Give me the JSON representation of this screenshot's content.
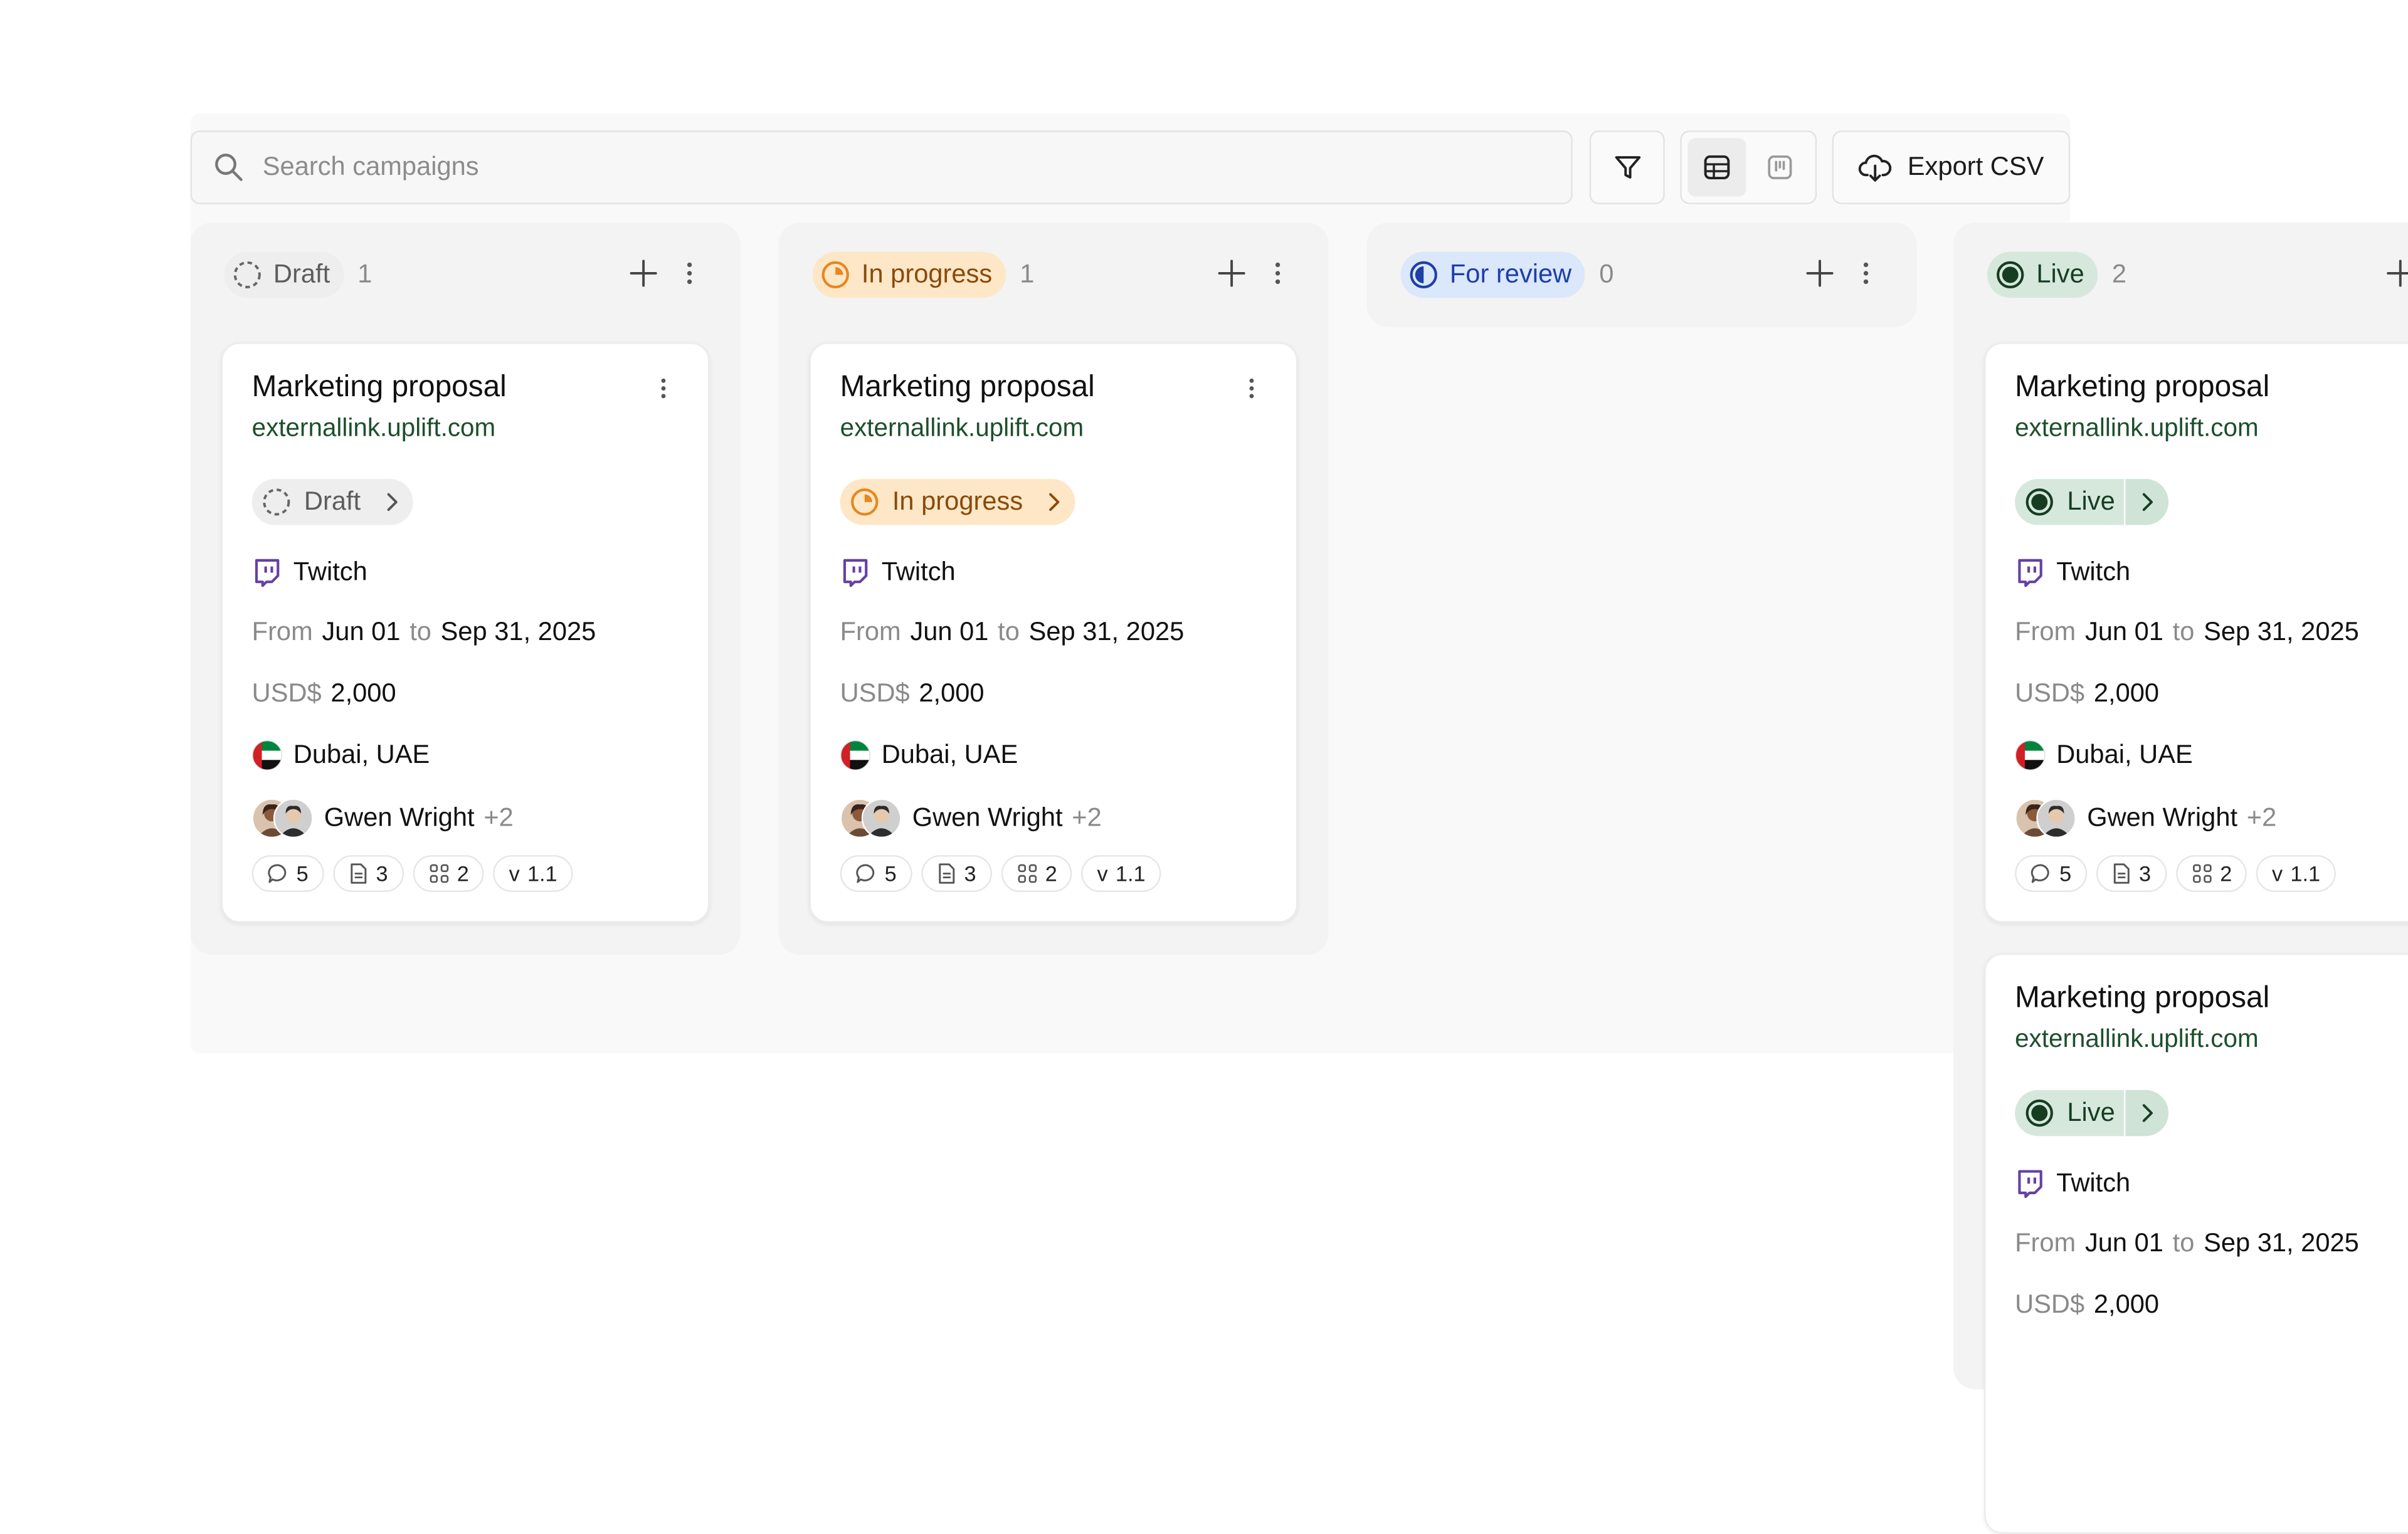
{
  "search": {
    "placeholder": "Search campaigns"
  },
  "toolbar": {
    "export_label": "Export CSV"
  },
  "columns": [
    {
      "status": "Draft",
      "count": "1",
      "cards": [
        {
          "title": "Marketing proposal",
          "link": "externallink.uplift.com",
          "status": "Draft",
          "platform": "Twitch",
          "from_label": "From",
          "from_date": "Jun 01",
          "to_label": "to",
          "to_date": "Sep 31, 2025",
          "currency": "USD$",
          "amount": "2,000",
          "location": "Dubai, UAE",
          "owner": "Gwen Wright",
          "extra": "+2",
          "comments": "5",
          "files": "3",
          "components": "2",
          "version_prefix": "v",
          "version": "1.1"
        }
      ]
    },
    {
      "status": "In progress",
      "count": "1",
      "cards": [
        {
          "title": "Marketing proposal",
          "link": "externallink.uplift.com",
          "status": "In progress",
          "platform": "Twitch",
          "from_label": "From",
          "from_date": "Jun 01",
          "to_label": "to",
          "to_date": "Sep 31, 2025",
          "currency": "USD$",
          "amount": "2,000",
          "location": "Dubai, UAE",
          "owner": "Gwen Wright",
          "extra": "+2",
          "comments": "5",
          "files": "3",
          "components": "2",
          "version_prefix": "v",
          "version": "1.1"
        }
      ]
    },
    {
      "status": "For review",
      "count": "0",
      "cards": []
    },
    {
      "status": "Live",
      "count": "2",
      "cards": [
        {
          "title": "Marketing proposal",
          "link": "externallink.uplift.com",
          "status": "Live",
          "platform": "Twitch",
          "from_label": "From",
          "from_date": "Jun 01",
          "to_label": "to",
          "to_date": "Sep 31, 2025",
          "currency": "USD$",
          "amount": "2,000",
          "location": "Dubai, UAE",
          "owner": "Gwen Wright",
          "extra": "+2",
          "comments": "5",
          "files": "3",
          "components": "2",
          "version_prefix": "v",
          "version": "1.1"
        },
        {
          "title": "Marketing proposal",
          "link": "externallink.uplift.com",
          "status": "Live",
          "platform": "Twitch",
          "from_label": "From",
          "from_date": "Jun 01",
          "to_label": "to",
          "to_date": "Sep 31, 2025",
          "currency": "USD$",
          "amount": "2,000"
        }
      ]
    }
  ],
  "colors": {
    "draft_bg": "#eeeeee",
    "draft_fg": "#5c5c5c",
    "progress_bg": "#fde7c7",
    "progress_fg": "#8a4a0b",
    "progress_icon": "#e8861f",
    "review_bg": "#dbe7fb",
    "review_fg": "#1d3fa6",
    "live_bg": "#d6e8dc",
    "live_fg": "#163d22",
    "link": "#1d4f2c",
    "twitch": "#6441a5"
  },
  "icons": [
    "search-icon",
    "filter-icon",
    "table-view-icon",
    "board-view-icon",
    "cloud-download-icon",
    "plus-icon",
    "more-vertical-icon",
    "chevron-right-icon",
    "twitch-icon",
    "uae-flag-icon",
    "comment-icon",
    "file-icon",
    "components-icon"
  ]
}
